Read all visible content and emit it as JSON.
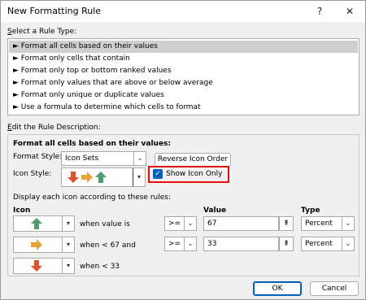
{
  "window": {
    "title": "New Formatting Rule",
    "help_button": "?",
    "close_button": "✕"
  },
  "rule_type": {
    "heading": "Select a Rule Type:",
    "heading_accel": "S",
    "heading_rest": "elect a Rule Type:",
    "items": [
      "► Format all cells based on their values",
      "► Format only cells that contain",
      "► Format only top or bottom ranked values",
      "► Format only values that are above or below average",
      "► Format only unique or duplicate values",
      "► Use a formula to determine which cells to format"
    ],
    "selected_index": 0
  },
  "description": {
    "heading": "Edit the Rule Description:",
    "heading_accel": "E",
    "heading_rest": "dit the Rule Description:",
    "section_title": "Format all cells based on their values:",
    "format_style_label": "Format Style:",
    "format_style_label_accel": "o",
    "format_style_value": "Icon Sets",
    "reverse_button": "Reverse Icon Order",
    "icon_style_label": "Icon Style:",
    "show_icon_only_label": "Show Icon Only",
    "show_icon_only_checked": true,
    "rules_caption": "Display each icon according to these rules:",
    "columns": {
      "icon": "Icon",
      "value": "Value",
      "type": "Type"
    },
    "rows": [
      {
        "icon": "green-up-arrow-icon",
        "condition": "when value is",
        "operator": ">=",
        "value": "67",
        "type": "Percent"
      },
      {
        "icon": "yellow-right-arrow-icon",
        "condition": "when < 67 and",
        "operator": ">=",
        "value": "33",
        "type": "Percent"
      },
      {
        "icon": "red-down-arrow-icon",
        "condition": "when < 33"
      }
    ]
  },
  "footer": {
    "ok": "OK",
    "cancel": "Cancel"
  },
  "colors": {
    "green": "#4e9d6b",
    "yellow": "#e8a33a",
    "red": "#d9542c",
    "accent": "#005fb8",
    "highlight": "#e01010"
  }
}
